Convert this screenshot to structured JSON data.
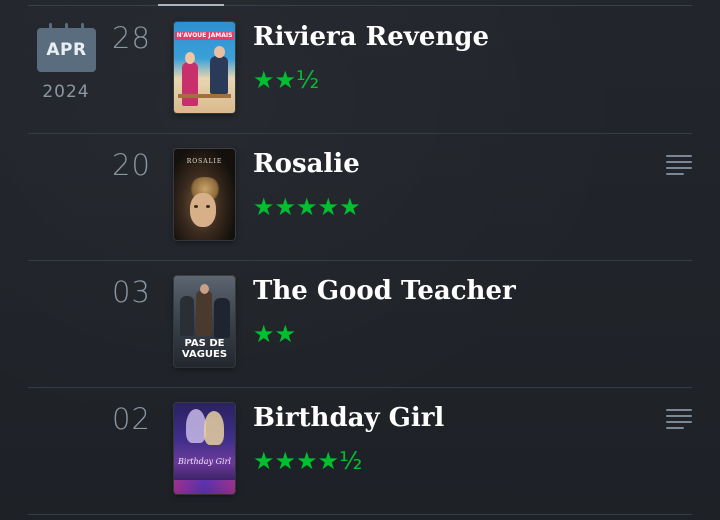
{
  "diary": {
    "month": "APR",
    "year": "2024",
    "entries": [
      {
        "day": "28",
        "title": "Riviera Revenge",
        "stars": "★★½",
        "poster_text": "N'AVOUE JAMAIS",
        "has_review": false
      },
      {
        "day": "20",
        "title": "Rosalie",
        "stars": "★★★★★",
        "poster_text": "ROSALIE",
        "has_review": true
      },
      {
        "day": "03",
        "title": "The Good Teacher",
        "stars": "★★",
        "poster_text": "PAS DE VAGUES",
        "has_review": false
      },
      {
        "day": "02",
        "title": "Birthday Girl",
        "stars": "★★★★½",
        "poster_text": "Birthday Girl",
        "has_review": true
      }
    ]
  },
  "colors": {
    "star_green": "#00c030",
    "background": "#1f2329",
    "calendar": "#5a6d7e"
  }
}
